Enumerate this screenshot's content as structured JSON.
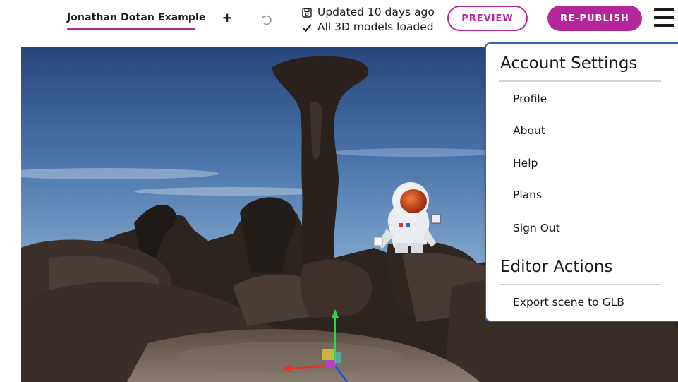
{
  "header": {
    "scene_title": "Jonathan Dotan Example",
    "add_label": "+",
    "status_saved": "Updated 10 days ago",
    "status_models": "All 3D models loaded",
    "preview_label": "PREVIEW",
    "republish_label": "RE-PUBLISH"
  },
  "colors": {
    "accent": "#b5269b",
    "menu_border": "#3b63b3"
  },
  "icons": [
    "plus-icon",
    "undo-icon",
    "save-icon",
    "checkmark-icon",
    "hamburger-menu-icon",
    "transform-gizmo-icon"
  ],
  "menu": {
    "account_heading": "Account Settings",
    "account_items": [
      "Profile",
      "About",
      "Help",
      "Plans",
      "Sign Out"
    ],
    "editor_heading": "Editor Actions",
    "editor_items": [
      "Export scene to GLB"
    ]
  }
}
